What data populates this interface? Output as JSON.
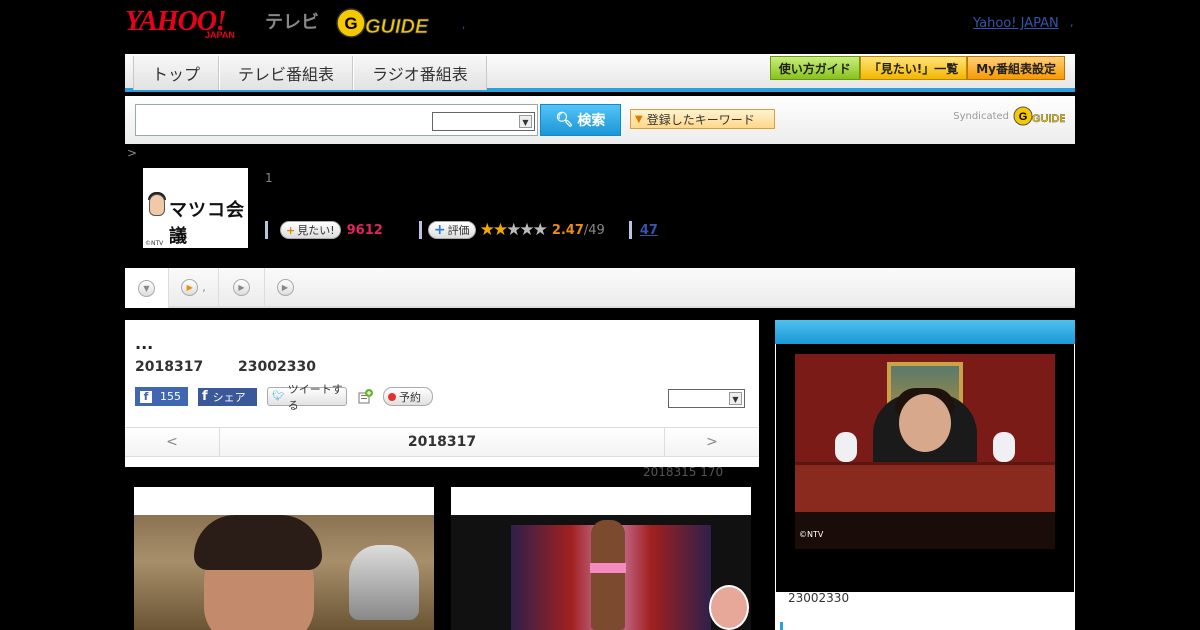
{
  "header": {
    "yahoo_logo": "YAHOO!",
    "yahoo_japan": "JAPAN",
    "tv_label": "テレビ",
    "gguide_logo": "G GUIDE",
    "dot": ",",
    "yahoo_japan_link": "Yahoo! JAPAN",
    "link_dot": ","
  },
  "nav": {
    "tabs": [
      "トップ",
      "テレビ番組表",
      "ラジオ番組表"
    ],
    "tools": [
      "使い方ガイド",
      "「見たい!」一覧",
      "My番組表設定"
    ]
  },
  "search": {
    "input_value": "",
    "select_value": "",
    "button_label": "検索",
    "keyword_button_label": "登録したキーワード",
    "syndicated": "Syndicated"
  },
  "breadcrumb": ">",
  "program": {
    "thumb_title": "マツコ会議",
    "thumb_copyright": "©NTV",
    "episode_number": "1",
    "want_label": "見たい!",
    "want_count": "9612",
    "rate_label": "評価",
    "rating": "2.47",
    "rating_count": "/49",
    "rating_value": 2.47,
    "review_count": "47"
  },
  "subtabs": {
    "tab2_text": ","
  },
  "episode": {
    "title": "...",
    "air_date": "2018317",
    "air_time": "23002330",
    "fb_like_count": "155",
    "fb_share_label": "シェア",
    "tweet_label": "ツイートする",
    "record_label": "予約",
    "select_value": "",
    "pager_prev": "<",
    "pager_current": "2018317",
    "pager_next": ">",
    "updated": "2018315  170"
  },
  "sidebar": {
    "image_copyright": "©NTV",
    "airtime": "23002330"
  },
  "colors": {
    "accent_blue": "#2aa0df",
    "want_pink": "#e0245e",
    "rating_orange": "#e88b12"
  }
}
